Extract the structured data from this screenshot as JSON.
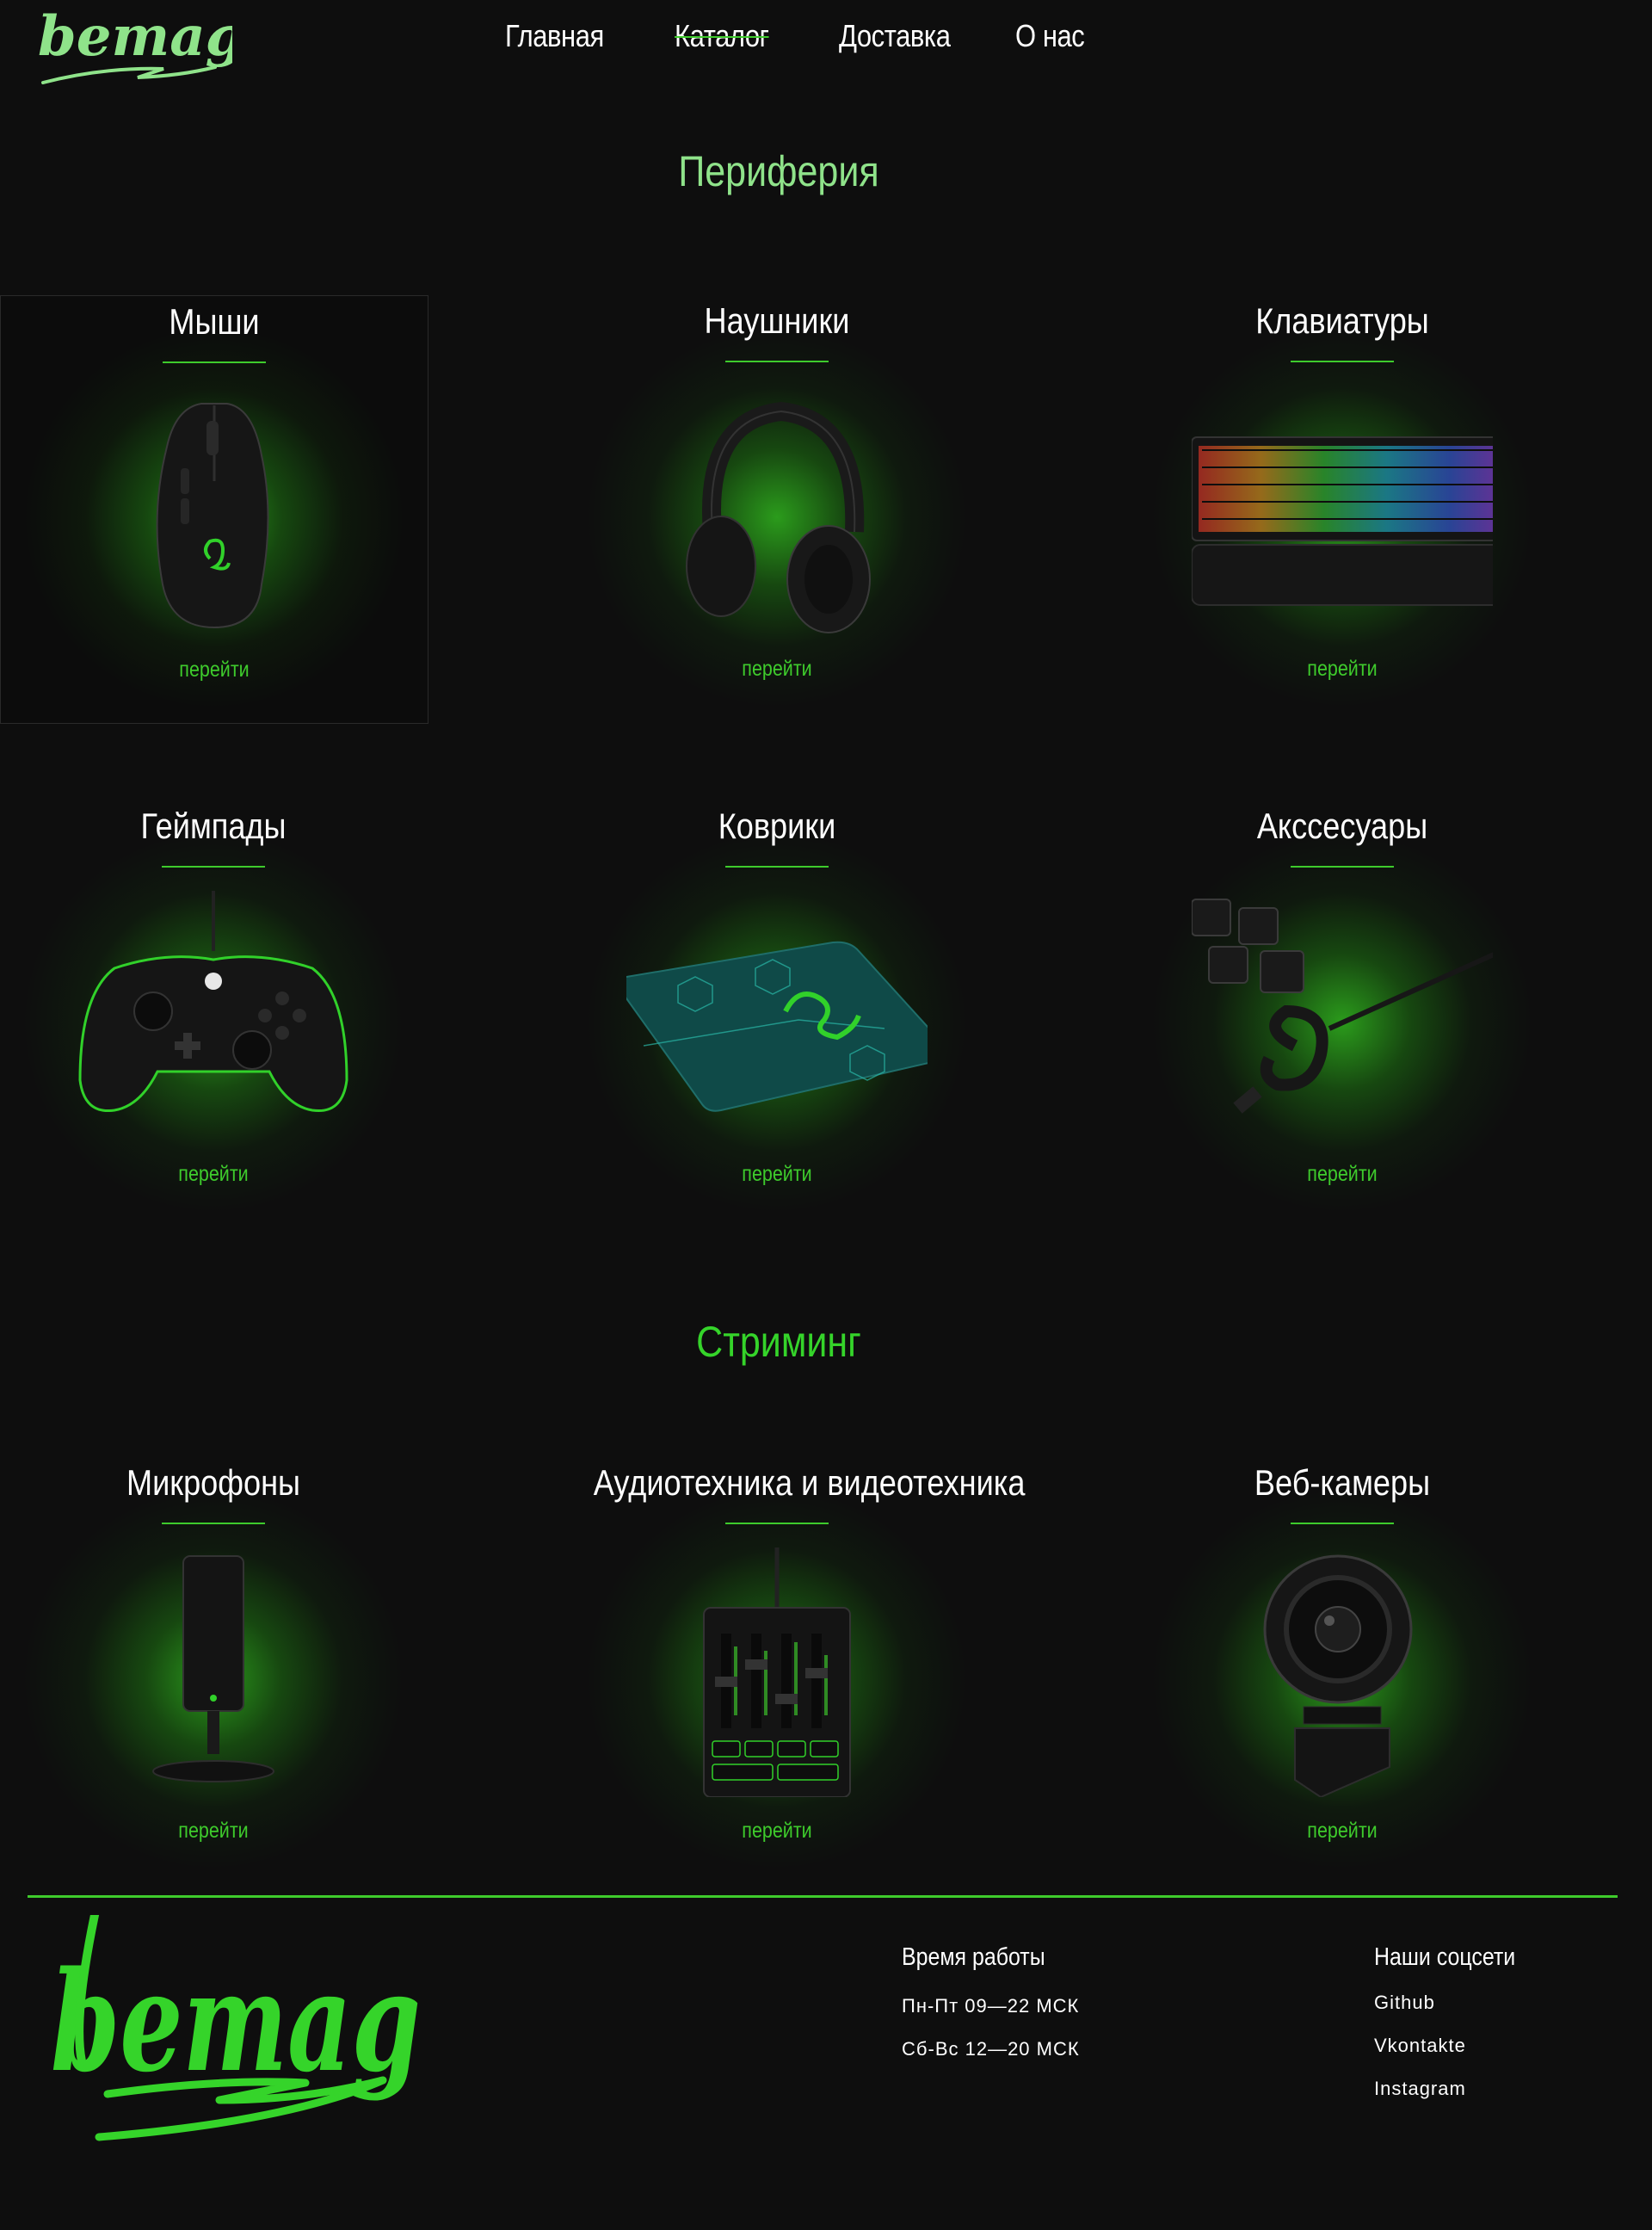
{
  "header": {
    "logo_text": "bemag",
    "nav": [
      {
        "label": "Главная"
      },
      {
        "label": "Каталог"
      },
      {
        "label": "Доставка"
      },
      {
        "label": "О нас"
      }
    ]
  },
  "sections": {
    "peripherals_title": "Периферия",
    "streaming_title": "Стриминг"
  },
  "cards": [
    {
      "title": "Мыши",
      "link": "перейти",
      "icon": "mouse"
    },
    {
      "title": "Наушники",
      "link": "перейти",
      "icon": "headphones"
    },
    {
      "title": "Клавиатуры",
      "link": "перейти",
      "icon": "keyboard"
    },
    {
      "title": "Геймпады",
      "link": "перейти",
      "icon": "gamepad"
    },
    {
      "title": "Коврики",
      "link": "перейти",
      "icon": "mousepad"
    },
    {
      "title": "Акссесуары",
      "link": "перейти",
      "icon": "keycaps-cable"
    },
    {
      "title": "Микрофоны",
      "link": "перейти",
      "icon": "microphone"
    },
    {
      "title": "Аудиотехника и видеотехника",
      "link": "перейти",
      "icon": "audio-mixer"
    },
    {
      "title": "Веб-камеры",
      "link": "перейти",
      "icon": "webcam"
    }
  ],
  "footer": {
    "logo_text": "bemag",
    "hours": {
      "title": "Время работы",
      "weekdays": "Пн-Пт 09—22 МСК",
      "weekend": "Сб-Вс 12—20 МСК"
    },
    "social": {
      "title": "Наши соцсети",
      "links": [
        "Github",
        "Vkontakte",
        "Instagram"
      ]
    }
  },
  "colors": {
    "background": "#0e0e0e",
    "accent": "#3ecb2c",
    "accent_light": "#8fe38a"
  }
}
